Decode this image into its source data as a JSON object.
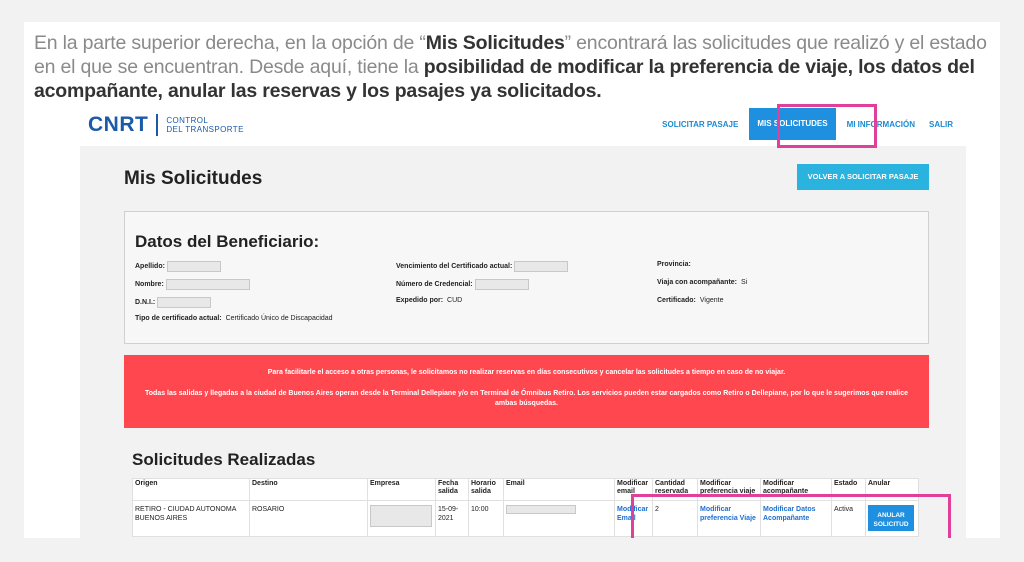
{
  "intro": {
    "p1": "En la parte superior derecha, en la opción de “",
    "b1": "Mis Solicitudes",
    "p2": "” encontrará las solicitudes que realizó y el estado en el que se encuentran. Desde aquí, tiene la ",
    "b2": "posibilidad de modificar la preferencia de viaje, los datos del acompañante, anular las reservas y los pasajes ya solicitados."
  },
  "header": {
    "logo_mark": "CNRT",
    "logo_line1": "CONTROL",
    "logo_line2": "DEL TRANSPORTE",
    "nav": [
      "SOLICITAR PASAJE",
      "MIS SOLICITUDES",
      "MI INFORMACIÓN",
      "SALIR"
    ]
  },
  "page": {
    "title": "Mis Solicitudes",
    "volver_label": "VOLVER A SOLICITAR PASAJE"
  },
  "beneficiario": {
    "title": "Datos del Beneficiario:",
    "apellido_label": "Apellido:",
    "nombre_label": "Nombre:",
    "dni_label": "D.N.I.:",
    "tipo_label": "Tipo de certificado actual:",
    "tipo_value": "Certificado Único de Discapacidad",
    "venc_label": "Vencimiento del Certificado actual:",
    "credencial_label": "Número de Credencial:",
    "expedido_label": "Expedido por:",
    "expedido_value": "CUD",
    "provincia_label": "Provincia:",
    "acompanante_label": "Viaja con acompañante:",
    "acompanante_value": "Si",
    "certificado_label": "Certificado:",
    "certificado_value": "Vigente"
  },
  "alert": {
    "line1": "Para facilitarle el acceso a otras personas, le solicitamos no realizar reservas en días consecutivos y cancelar las solicitudes a tiempo en caso de no viajar.",
    "line2": "Todas las salidas y llegadas a la ciudad de Buenos Aires operan desde la Terminal Dellepiane y/o en Terminal de Ómnibus Retiro. Los servicios pueden estar cargados como Retiro o Dellepiane, por lo que le sugerimos que realice ambas búsquedas."
  },
  "solicitudes": {
    "title": "Solicitudes Realizadas",
    "headers": [
      "Origen",
      "Destino",
      "Empresa",
      "Fecha salida",
      "Horario salida",
      "Email",
      "Modificar email",
      "Cantidad reservada",
      "Modificar preferencia viaje",
      "Modificar acompañante",
      "Estado",
      "Anular"
    ],
    "row": {
      "origen": "RETIRO - CIUDAD AUTONOMA BUENOS AIRES",
      "destino": "ROSARIO",
      "fecha": "15-09-2021",
      "horario": "10:00",
      "mod_email": "Modificar Email",
      "cantidad": "2",
      "mod_pref": "Modificar preferencia Viaje",
      "mod_acomp": "Modificar Datos Acompañante",
      "estado": "Activa",
      "anular": "ANULAR SOLICITUD"
    }
  }
}
